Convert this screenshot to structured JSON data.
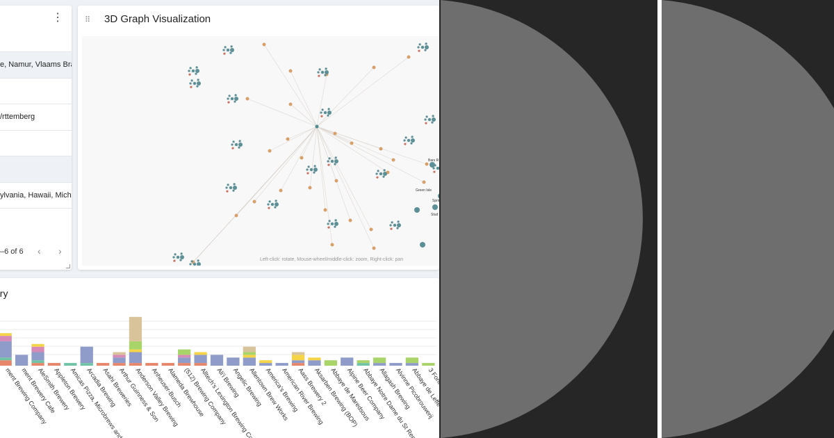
{
  "table_panel": {
    "menu_icon": "kebab-vertical-icon",
    "rows": [
      {
        "text": "e, Namur, Vlaams Braba",
        "shaded": true
      },
      {
        "text": "",
        "shaded": false
      },
      {
        "text": "/rttemberg",
        "shaded": false
      },
      {
        "text": "",
        "shaded": false
      },
      {
        "text": "",
        "shaded": true
      },
      {
        "text": "ylvania, Hawaii, Michiga",
        "shaded": false
      },
      {
        "text": "",
        "shaded": false
      }
    ],
    "pagination": "–6 of 6",
    "prev_icon": "chevron-left-icon",
    "next_icon": "chevron-right-icon",
    "prev_glyph": "‹",
    "next_glyph": "›"
  },
  "graph_panel": {
    "drag_icon": "drag-handle-icon",
    "drag_glyph": "⠿",
    "title": "3D Graph Visualization",
    "hint": "Left-click: rotate, Mouse-wheel/middle-click: zoom, Right-click: pan",
    "node_labels": [
      "Bars R",
      "Green Isle",
      "Spring",
      "Stud"
    ]
  },
  "bar_panel": {
    "title": "ery",
    "chart_data": {
      "type": "bar",
      "stacked": true,
      "categories": [
        "ment Brewing Company",
        "ment Brewery Cafe",
        "AleSmith Brewery",
        "Appleton Brewery",
        "Amicas Pizza, Microbrews and More",
        "Arcadia Brewing",
        "Asahi Breweries",
        "Arthur Guinness & Son",
        "Anderson Valley Brewing",
        "Anheuser-Busch",
        "Alameda Brewhouse",
        "(512) Brewing Company",
        "Alltech's Lexington Brewing Company",
        "Ali'i Brewing",
        "Angelic Brewing",
        "Allentown Brew Works",
        "America's Brewing",
        "American River Brewing",
        "Aass Brewery 2",
        "Aksarben Brewing (BOP)",
        "Abbaye de Maredsous",
        "Alpine Beer Company",
        "Abbaye Notre Dame du St Remy",
        "Allagash Brewing",
        "Alvinne Picobrouwerij",
        "Abbaye de Leffe",
        "3 Fonteinen"
      ],
      "series": [
        {
          "values": [
            2,
            0,
            1,
            1,
            0,
            0,
            1,
            1,
            1,
            1,
            1,
            1,
            1,
            0,
            0,
            0,
            0,
            0,
            1,
            0,
            0,
            0,
            0,
            0,
            0,
            0,
            0
          ]
        },
        {
          "values": [
            1,
            0,
            1,
            0,
            1,
            1,
            0,
            0,
            0,
            0,
            0,
            0,
            0,
            0,
            0,
            0,
            0,
            0,
            0,
            0,
            0,
            0,
            1,
            0,
            0,
            0,
            0
          ]
        },
        {
          "values": [
            6,
            4,
            3,
            0,
            0,
            6,
            0,
            2,
            4,
            0,
            0,
            2,
            3,
            4,
            3,
            3,
            1,
            1,
            1,
            2,
            0,
            3,
            0,
            1,
            1,
            1,
            0
          ]
        },
        {
          "values": [
            2,
            0,
            2,
            0,
            0,
            0,
            0,
            1,
            0,
            0,
            0,
            1,
            0,
            0,
            0,
            0,
            0,
            0,
            0,
            0,
            0,
            0,
            0,
            0,
            0,
            0,
            0
          ]
        },
        {
          "values": [
            1,
            0,
            1,
            0,
            0,
            0,
            0,
            0,
            1,
            0,
            0,
            0,
            1,
            0,
            0,
            1,
            1,
            0,
            2,
            1,
            0,
            0,
            0,
            0,
            0,
            0,
            0
          ]
        },
        {
          "values": [
            0,
            0,
            0,
            0,
            0,
            0,
            0,
            0,
            3,
            0,
            0,
            2,
            0,
            0,
            0,
            1,
            0,
            0,
            0,
            0,
            2,
            0,
            1,
            2,
            0,
            2,
            1
          ]
        },
        {
          "values": [
            0,
            0,
            0,
            0,
            0,
            0,
            0,
            1,
            9,
            0,
            0,
            0,
            0,
            0,
            0,
            2,
            0,
            0,
            1,
            0,
            0,
            0,
            0,
            0,
            0,
            0,
            0
          ]
        }
      ],
      "colors": [
        "#e8866b",
        "#71c3a5",
        "#8f9bc8",
        "#d78ab8",
        "#f5d447",
        "#a8d46a",
        "#d9c39a"
      ],
      "xlabel": "",
      "ylabel": ""
    }
  },
  "right_area": {
    "left_shape": "half-disc",
    "right_shape": "half-disc",
    "bg_color": "#262626",
    "shape_color": "#6e6e6e"
  }
}
